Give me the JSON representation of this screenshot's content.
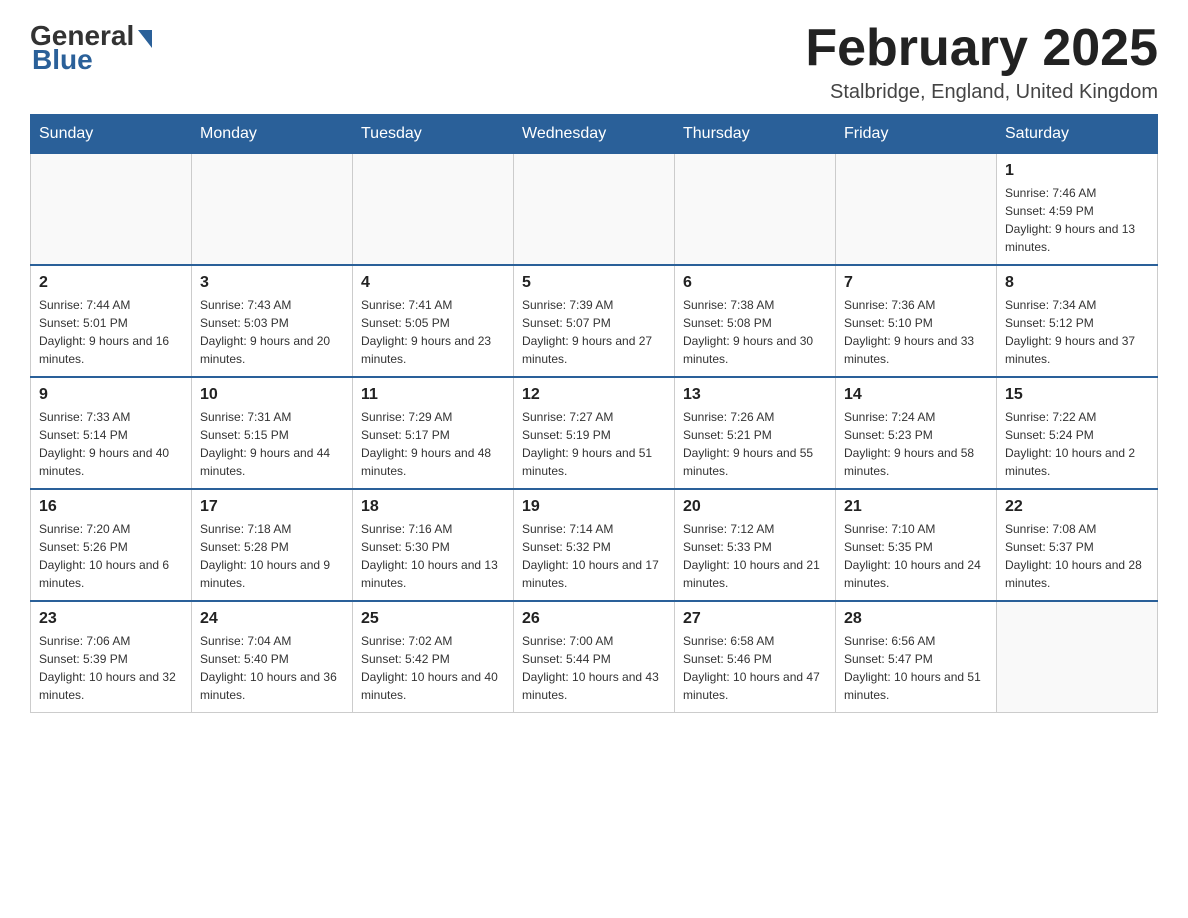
{
  "header": {
    "logo": {
      "general": "General",
      "blue": "Blue"
    },
    "title": "February 2025",
    "location": "Stalbridge, England, United Kingdom"
  },
  "weekdays": [
    "Sunday",
    "Monday",
    "Tuesday",
    "Wednesday",
    "Thursday",
    "Friday",
    "Saturday"
  ],
  "weeks": [
    [
      {
        "day": "",
        "sunrise": "",
        "sunset": "",
        "daylight": "",
        "empty": true
      },
      {
        "day": "",
        "sunrise": "",
        "sunset": "",
        "daylight": "",
        "empty": true
      },
      {
        "day": "",
        "sunrise": "",
        "sunset": "",
        "daylight": "",
        "empty": true
      },
      {
        "day": "",
        "sunrise": "",
        "sunset": "",
        "daylight": "",
        "empty": true
      },
      {
        "day": "",
        "sunrise": "",
        "sunset": "",
        "daylight": "",
        "empty": true
      },
      {
        "day": "",
        "sunrise": "",
        "sunset": "",
        "daylight": "",
        "empty": true
      },
      {
        "day": "1",
        "sunrise": "Sunrise: 7:46 AM",
        "sunset": "Sunset: 4:59 PM",
        "daylight": "Daylight: 9 hours and 13 minutes.",
        "empty": false
      }
    ],
    [
      {
        "day": "2",
        "sunrise": "Sunrise: 7:44 AM",
        "sunset": "Sunset: 5:01 PM",
        "daylight": "Daylight: 9 hours and 16 minutes.",
        "empty": false
      },
      {
        "day": "3",
        "sunrise": "Sunrise: 7:43 AM",
        "sunset": "Sunset: 5:03 PM",
        "daylight": "Daylight: 9 hours and 20 minutes.",
        "empty": false
      },
      {
        "day": "4",
        "sunrise": "Sunrise: 7:41 AM",
        "sunset": "Sunset: 5:05 PM",
        "daylight": "Daylight: 9 hours and 23 minutes.",
        "empty": false
      },
      {
        "day": "5",
        "sunrise": "Sunrise: 7:39 AM",
        "sunset": "Sunset: 5:07 PM",
        "daylight": "Daylight: 9 hours and 27 minutes.",
        "empty": false
      },
      {
        "day": "6",
        "sunrise": "Sunrise: 7:38 AM",
        "sunset": "Sunset: 5:08 PM",
        "daylight": "Daylight: 9 hours and 30 minutes.",
        "empty": false
      },
      {
        "day": "7",
        "sunrise": "Sunrise: 7:36 AM",
        "sunset": "Sunset: 5:10 PM",
        "daylight": "Daylight: 9 hours and 33 minutes.",
        "empty": false
      },
      {
        "day": "8",
        "sunrise": "Sunrise: 7:34 AM",
        "sunset": "Sunset: 5:12 PM",
        "daylight": "Daylight: 9 hours and 37 minutes.",
        "empty": false
      }
    ],
    [
      {
        "day": "9",
        "sunrise": "Sunrise: 7:33 AM",
        "sunset": "Sunset: 5:14 PM",
        "daylight": "Daylight: 9 hours and 40 minutes.",
        "empty": false
      },
      {
        "day": "10",
        "sunrise": "Sunrise: 7:31 AM",
        "sunset": "Sunset: 5:15 PM",
        "daylight": "Daylight: 9 hours and 44 minutes.",
        "empty": false
      },
      {
        "day": "11",
        "sunrise": "Sunrise: 7:29 AM",
        "sunset": "Sunset: 5:17 PM",
        "daylight": "Daylight: 9 hours and 48 minutes.",
        "empty": false
      },
      {
        "day": "12",
        "sunrise": "Sunrise: 7:27 AM",
        "sunset": "Sunset: 5:19 PM",
        "daylight": "Daylight: 9 hours and 51 minutes.",
        "empty": false
      },
      {
        "day": "13",
        "sunrise": "Sunrise: 7:26 AM",
        "sunset": "Sunset: 5:21 PM",
        "daylight": "Daylight: 9 hours and 55 minutes.",
        "empty": false
      },
      {
        "day": "14",
        "sunrise": "Sunrise: 7:24 AM",
        "sunset": "Sunset: 5:23 PM",
        "daylight": "Daylight: 9 hours and 58 minutes.",
        "empty": false
      },
      {
        "day": "15",
        "sunrise": "Sunrise: 7:22 AM",
        "sunset": "Sunset: 5:24 PM",
        "daylight": "Daylight: 10 hours and 2 minutes.",
        "empty": false
      }
    ],
    [
      {
        "day": "16",
        "sunrise": "Sunrise: 7:20 AM",
        "sunset": "Sunset: 5:26 PM",
        "daylight": "Daylight: 10 hours and 6 minutes.",
        "empty": false
      },
      {
        "day": "17",
        "sunrise": "Sunrise: 7:18 AM",
        "sunset": "Sunset: 5:28 PM",
        "daylight": "Daylight: 10 hours and 9 minutes.",
        "empty": false
      },
      {
        "day": "18",
        "sunrise": "Sunrise: 7:16 AM",
        "sunset": "Sunset: 5:30 PM",
        "daylight": "Daylight: 10 hours and 13 minutes.",
        "empty": false
      },
      {
        "day": "19",
        "sunrise": "Sunrise: 7:14 AM",
        "sunset": "Sunset: 5:32 PM",
        "daylight": "Daylight: 10 hours and 17 minutes.",
        "empty": false
      },
      {
        "day": "20",
        "sunrise": "Sunrise: 7:12 AM",
        "sunset": "Sunset: 5:33 PM",
        "daylight": "Daylight: 10 hours and 21 minutes.",
        "empty": false
      },
      {
        "day": "21",
        "sunrise": "Sunrise: 7:10 AM",
        "sunset": "Sunset: 5:35 PM",
        "daylight": "Daylight: 10 hours and 24 minutes.",
        "empty": false
      },
      {
        "day": "22",
        "sunrise": "Sunrise: 7:08 AM",
        "sunset": "Sunset: 5:37 PM",
        "daylight": "Daylight: 10 hours and 28 minutes.",
        "empty": false
      }
    ],
    [
      {
        "day": "23",
        "sunrise": "Sunrise: 7:06 AM",
        "sunset": "Sunset: 5:39 PM",
        "daylight": "Daylight: 10 hours and 32 minutes.",
        "empty": false
      },
      {
        "day": "24",
        "sunrise": "Sunrise: 7:04 AM",
        "sunset": "Sunset: 5:40 PM",
        "daylight": "Daylight: 10 hours and 36 minutes.",
        "empty": false
      },
      {
        "day": "25",
        "sunrise": "Sunrise: 7:02 AM",
        "sunset": "Sunset: 5:42 PM",
        "daylight": "Daylight: 10 hours and 40 minutes.",
        "empty": false
      },
      {
        "day": "26",
        "sunrise": "Sunrise: 7:00 AM",
        "sunset": "Sunset: 5:44 PM",
        "daylight": "Daylight: 10 hours and 43 minutes.",
        "empty": false
      },
      {
        "day": "27",
        "sunrise": "Sunrise: 6:58 AM",
        "sunset": "Sunset: 5:46 PM",
        "daylight": "Daylight: 10 hours and 47 minutes.",
        "empty": false
      },
      {
        "day": "28",
        "sunrise": "Sunrise: 6:56 AM",
        "sunset": "Sunset: 5:47 PM",
        "daylight": "Daylight: 10 hours and 51 minutes.",
        "empty": false
      },
      {
        "day": "",
        "sunrise": "",
        "sunset": "",
        "daylight": "",
        "empty": true
      }
    ]
  ]
}
